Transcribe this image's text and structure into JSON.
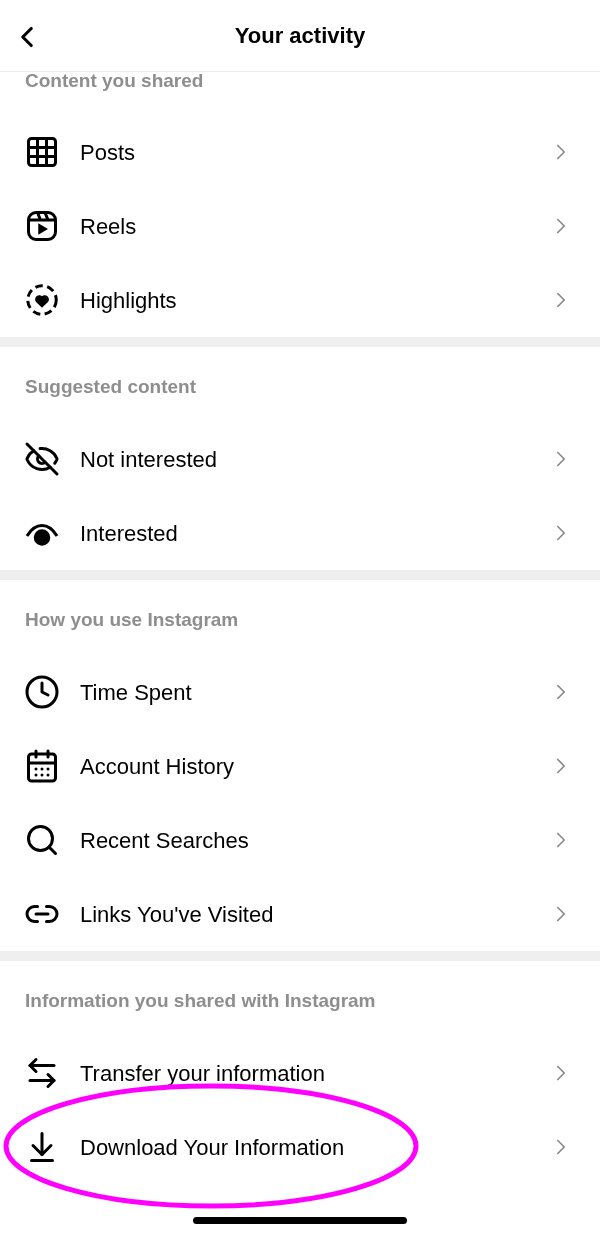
{
  "header": {
    "title": "Your activity"
  },
  "sections": [
    {
      "label": "Content you shared",
      "items": [
        {
          "kind": "grid",
          "label": "Posts",
          "highlighted": false
        },
        {
          "kind": "reels",
          "label": "Reels",
          "highlighted": false
        },
        {
          "kind": "heart-circle",
          "label": "Highlights",
          "highlighted": false
        }
      ]
    },
    {
      "label": "Suggested content",
      "items": [
        {
          "kind": "eye-off",
          "label": "Not interested",
          "highlighted": false
        },
        {
          "kind": "eye",
          "label": "Interested",
          "highlighted": false
        }
      ]
    },
    {
      "label": "How you use Instagram",
      "items": [
        {
          "kind": "clock",
          "label": "Time Spent",
          "highlighted": false
        },
        {
          "kind": "calendar",
          "label": "Account History",
          "highlighted": false
        },
        {
          "kind": "search",
          "label": "Recent Searches",
          "highlighted": false
        },
        {
          "kind": "link",
          "label": "Links You've Visited",
          "highlighted": false
        }
      ]
    },
    {
      "label": "Information you shared with Instagram",
      "items": [
        {
          "kind": "transfer",
          "label": "Transfer your information",
          "highlighted": false
        },
        {
          "kind": "download",
          "label": "Download Your Information",
          "highlighted": true
        }
      ]
    }
  ]
}
